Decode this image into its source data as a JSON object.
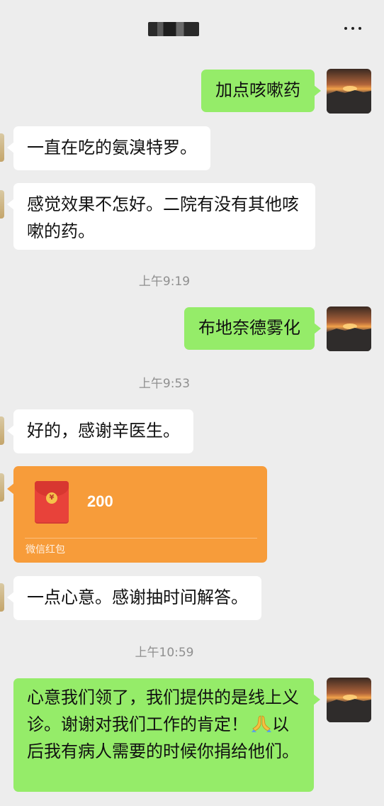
{
  "header": {
    "more_icon": "more-horizontal-icon"
  },
  "messages": [
    {
      "side": "out",
      "text": "加点咳嗽药"
    },
    {
      "side": "in",
      "text": "一直在吃的氨溴特罗。"
    },
    {
      "side": "in",
      "text": "感觉效果不怎好。二院有没有其他咳嗽的药。"
    },
    {
      "side": "out",
      "text": "布地奈德雾化"
    },
    {
      "side": "in",
      "text": "好的，感谢辛医生。"
    },
    {
      "side": "in",
      "text": "一点心意。感谢抽时间解答。"
    },
    {
      "side": "out",
      "text": "心意我们领了，我们提供的是线上义诊。谢谢对我们工作的肯定！",
      "emoji": "folded-hands-emoji",
      "text_after": "以后我有病人需要的时候你捐给他们。"
    }
  ],
  "timestamps": [
    "上午9:19",
    "上午9:53",
    "上午10:59"
  ],
  "red_packet": {
    "amount": "200",
    "label": "微信红包",
    "color": "#f79c3a"
  },
  "colors": {
    "background": "#ededed",
    "outgoing_bubble": "#95ec69",
    "incoming_bubble": "#ffffff"
  }
}
